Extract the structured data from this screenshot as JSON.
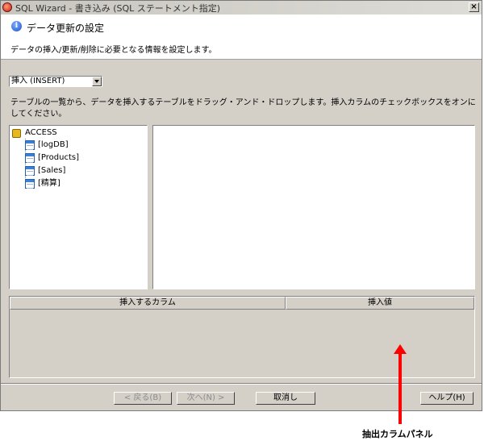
{
  "window": {
    "title": "SQL Wizard - 書き込み (SQL ステートメント指定)",
    "close_glyph": "×"
  },
  "header": {
    "title": "データ更新の設定",
    "description": "データの挿入/更新/削除に必要となる情報を設定します。"
  },
  "operation_select": {
    "value": "挿入 (INSERT)"
  },
  "instruction": "テーブルの一覧から、データを挿入するテーブルをドラッグ・アンド・ドロップします。挿入カラムのチェックボックスをオンにしてください。",
  "tree": {
    "root": "ACCESS",
    "items": [
      "[logDB]",
      "[Products]",
      "[Sales]",
      "[精算]"
    ]
  },
  "column_table": {
    "headers": [
      "挿入するカラム",
      "挿入値"
    ]
  },
  "buttons": {
    "back": "< 戻る(B)",
    "next": "次へ(N) >",
    "cancel": "取消し",
    "help": "ヘルプ(H)"
  },
  "annotation": "抽出カラムパネル",
  "colors": {
    "annotation_arrow": "#ff0000",
    "dialog_bg": "#d4d0c8"
  }
}
